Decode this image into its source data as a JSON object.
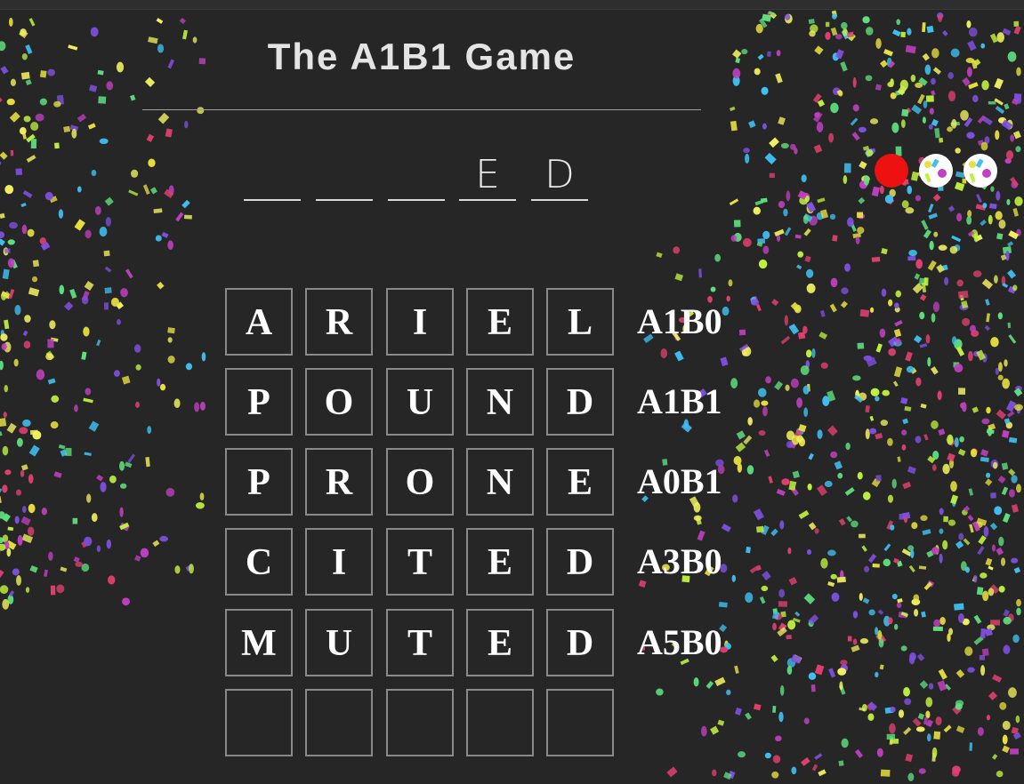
{
  "game": {
    "title": "The A1B1 Game"
  },
  "hint": {
    "slots": [
      "",
      "",
      "",
      "E",
      "D"
    ]
  },
  "indicators": [
    {
      "name": "red-dot",
      "color": "#ee1111"
    },
    {
      "name": "confetti-dot-1",
      "color": "#ffffff"
    },
    {
      "name": "confetti-dot-2",
      "color": "#ffffff"
    }
  ],
  "board": {
    "rows": [
      {
        "letters": [
          "A",
          "R",
          "I",
          "E",
          "L"
        ],
        "score": "A1B0"
      },
      {
        "letters": [
          "P",
          "O",
          "U",
          "N",
          "D"
        ],
        "score": "A1B1"
      },
      {
        "letters": [
          "P",
          "R",
          "O",
          "N",
          "E"
        ],
        "score": "A0B1"
      },
      {
        "letters": [
          "C",
          "I",
          "T",
          "E",
          "D"
        ],
        "score": "A3B0"
      },
      {
        "letters": [
          "M",
          "U",
          "T",
          "E",
          "D"
        ],
        "score": "A5B0"
      },
      {
        "letters": [
          "",
          "",
          "",
          "",
          ""
        ],
        "score": ""
      }
    ]
  },
  "colors": {
    "background": "#262626",
    "confetti": [
      "#e8e040",
      "#c0f040",
      "#40c0f0",
      "#8050e0",
      "#e04070",
      "#f0f060",
      "#60e080",
      "#c040c0"
    ]
  }
}
